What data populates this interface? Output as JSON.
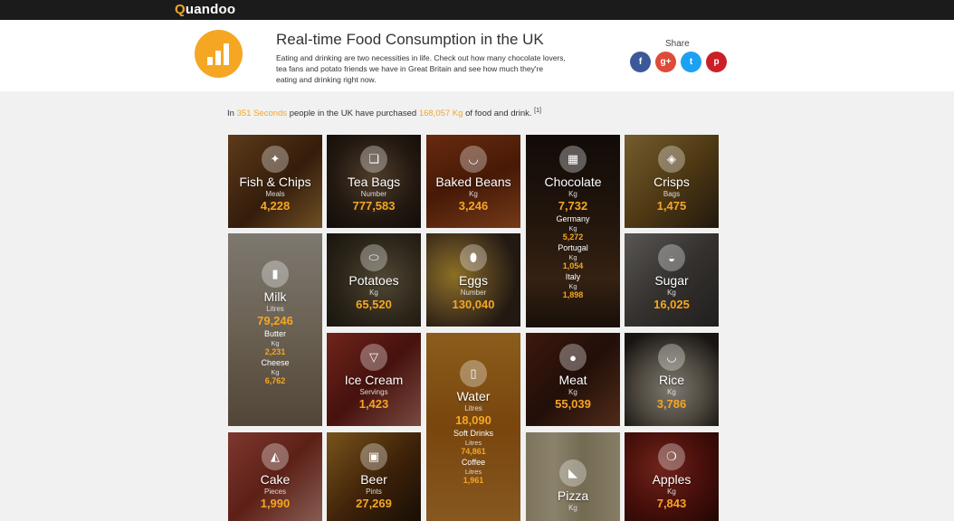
{
  "brand": {
    "logo_first": "Q",
    "logo_rest": "uandoo"
  },
  "header": {
    "title": "Real-time Food Consumption in the UK",
    "description": "Eating and drinking are two necessities in life. Check out how many chocolate lovers, tea fans and potato friends we have in Great Britain and see how much they're eating and drinking right now.",
    "share_label": "Share",
    "share_buttons": [
      {
        "label": "f",
        "color": "#3b5998"
      },
      {
        "label": "g+",
        "color": "#dd4b39"
      },
      {
        "label": "t",
        "color": "#1da1f2"
      },
      {
        "label": "p",
        "color": "#cb2027"
      }
    ]
  },
  "intro": {
    "prefix": "In",
    "seconds": "351 Seconds",
    "middle": "people in the UK have purchased",
    "amount": "168,057 Kg",
    "suffix": "of food and drink.",
    "ref": "[1]"
  },
  "tiles": {
    "fish": {
      "name": "Fish & Chips",
      "unit": "Meals",
      "value": "4,228"
    },
    "tea": {
      "name": "Tea Bags",
      "unit": "Number",
      "value": "777,583"
    },
    "beans": {
      "name": "Baked Beans",
      "unit": "Kg",
      "value": "3,246"
    },
    "chocolate": {
      "name": "Chocolate",
      "unit": "Kg",
      "value": "7,732",
      "subs": [
        {
          "name": "Germany",
          "unit": "Kg",
          "value": "5,272"
        },
        {
          "name": "Portugal",
          "unit": "Kg",
          "value": "1,054"
        },
        {
          "name": "Italy",
          "unit": "Kg",
          "value": "1,898"
        }
      ]
    },
    "crisps": {
      "name": "Crisps",
      "unit": "Bags",
      "value": "1,475"
    },
    "milk": {
      "name": "Milk",
      "unit": "Litres",
      "value": "79,246",
      "subs": [
        {
          "name": "Butter",
          "unit": "Kg",
          "value": "2,231"
        },
        {
          "name": "Cheese",
          "unit": "Kg",
          "value": "6,762"
        }
      ]
    },
    "potatoes": {
      "name": "Potatoes",
      "unit": "Kg",
      "value": "65,520"
    },
    "eggs": {
      "name": "Eggs",
      "unit": "Number",
      "value": "130,040"
    },
    "sugar": {
      "name": "Sugar",
      "unit": "Kg",
      "value": "16,025"
    },
    "icecream": {
      "name": "Ice Cream",
      "unit": "Servings",
      "value": "1,423"
    },
    "water": {
      "name": "Water",
      "unit": "Litres",
      "value": "18,090",
      "subs": [
        {
          "name": "Soft Drinks",
          "unit": "Litres",
          "value": "74,861"
        },
        {
          "name": "Coffee",
          "unit": "Litres",
          "value": "1,961"
        }
      ]
    },
    "meat": {
      "name": "Meat",
      "unit": "Kg",
      "value": "55,039"
    },
    "rice": {
      "name": "Rice",
      "unit": "Kg",
      "value": "3,786"
    },
    "cake": {
      "name": "Cake",
      "unit": "Pieces",
      "value": "1,990"
    },
    "beer": {
      "name": "Beer",
      "unit": "Pints",
      "value": "27,269"
    },
    "pizza": {
      "name": "Pizza",
      "unit": "Kg"
    },
    "apples": {
      "name": "Apples",
      "unit": "Kg",
      "value": "7,843"
    }
  }
}
